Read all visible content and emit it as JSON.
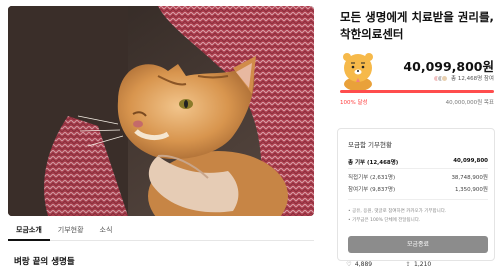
{
  "campaign": {
    "title": "모든 생명에게 치료받을 권리를, 착한의료센터",
    "amount": "40,099,800원",
    "participants": "총 12,468명 참여",
    "rate": "100% 달성",
    "goal": "40,000,000원 목표"
  },
  "tabs": [
    {
      "label": "모금소개"
    },
    {
      "label": "기부현황"
    },
    {
      "label": "소식"
    }
  ],
  "story": {
    "title": "벼랑 끝의 생명들"
  },
  "donation_card": {
    "title": "모금함 기부현황",
    "rows": [
      {
        "label": "총 기부 (12,468명)",
        "value": "40,099,800"
      },
      {
        "label": "직접기부 (2,631명)",
        "value": "38,748,900원"
      },
      {
        "label": "참여기부 (9,837명)",
        "value": "1,350,900원"
      }
    ],
    "notes": [
      "• 공유, 응원, 댓글로 참여하면 카카오가 기부합니다.",
      "• 기부금은 100% 단체에 전달됩니다."
    ],
    "button": "모금종료"
  },
  "footer": {
    "likes": "4,889",
    "shares": "1,210"
  },
  "colors": {
    "accent": "#ff4d4d",
    "button": "#8c8c8c"
  }
}
